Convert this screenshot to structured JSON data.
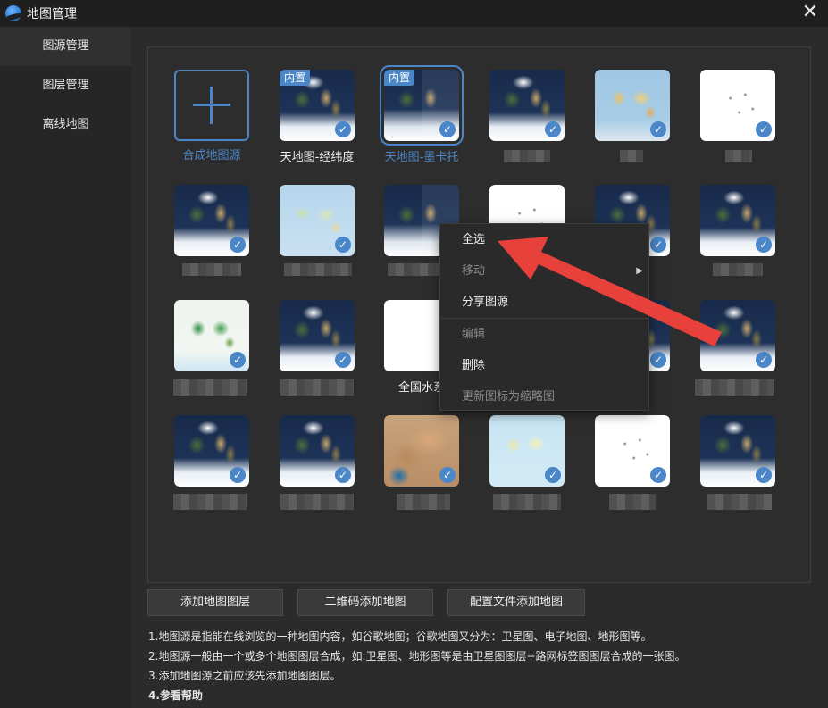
{
  "window": {
    "title": "地图管理",
    "close_glyph": "✕"
  },
  "sidebar": {
    "items": [
      {
        "label": "图源管理",
        "active": true
      },
      {
        "label": "图层管理",
        "active": false
      },
      {
        "label": "离线地图",
        "active": false
      }
    ]
  },
  "grid": {
    "add_tile_label": "合成地图源",
    "badge_text": "内置",
    "check_glyph": "✓",
    "tiles": [
      {
        "label": "天地图-经纬度",
        "badge": true,
        "selected": false
      },
      {
        "label": "天地图-墨卡托",
        "badge": true,
        "selected": true
      },
      {
        "label": "全国水系",
        "badge": false,
        "selected": false
      }
    ]
  },
  "context_menu": {
    "items": [
      {
        "label": "全选",
        "disabled": false,
        "submenu": false
      },
      {
        "label": "移动",
        "disabled": true,
        "submenu": true
      },
      {
        "label": "分享图源",
        "disabled": false,
        "submenu": true
      },
      {
        "label": "编辑",
        "disabled": true,
        "submenu": false
      },
      {
        "label": "删除",
        "disabled": false,
        "submenu": false
      },
      {
        "label": "更新图标为缩略图",
        "disabled": true,
        "submenu": false
      }
    ],
    "submenu_glyph": "▶"
  },
  "buttons": {
    "add_layer": "添加地图图层",
    "qr_add": "二维码添加地图",
    "config_add": "配置文件添加地图"
  },
  "notes": [
    "1.地图源是指能在线浏览的一种地图内容，如谷歌地图；谷歌地图又分为：卫星图、电子地图、地形图等。",
    "2.地图源一般由一个或多个地图图层合成，如:卫星图、地形图等是由卫星图图层+路网标签图图层合成的一张图。",
    "3.添加地图源之前应该先添加地图图层。",
    "4.参看帮助"
  ],
  "colors": {
    "accent": "#4a86c8",
    "annotation_arrow": "#e8403a"
  }
}
